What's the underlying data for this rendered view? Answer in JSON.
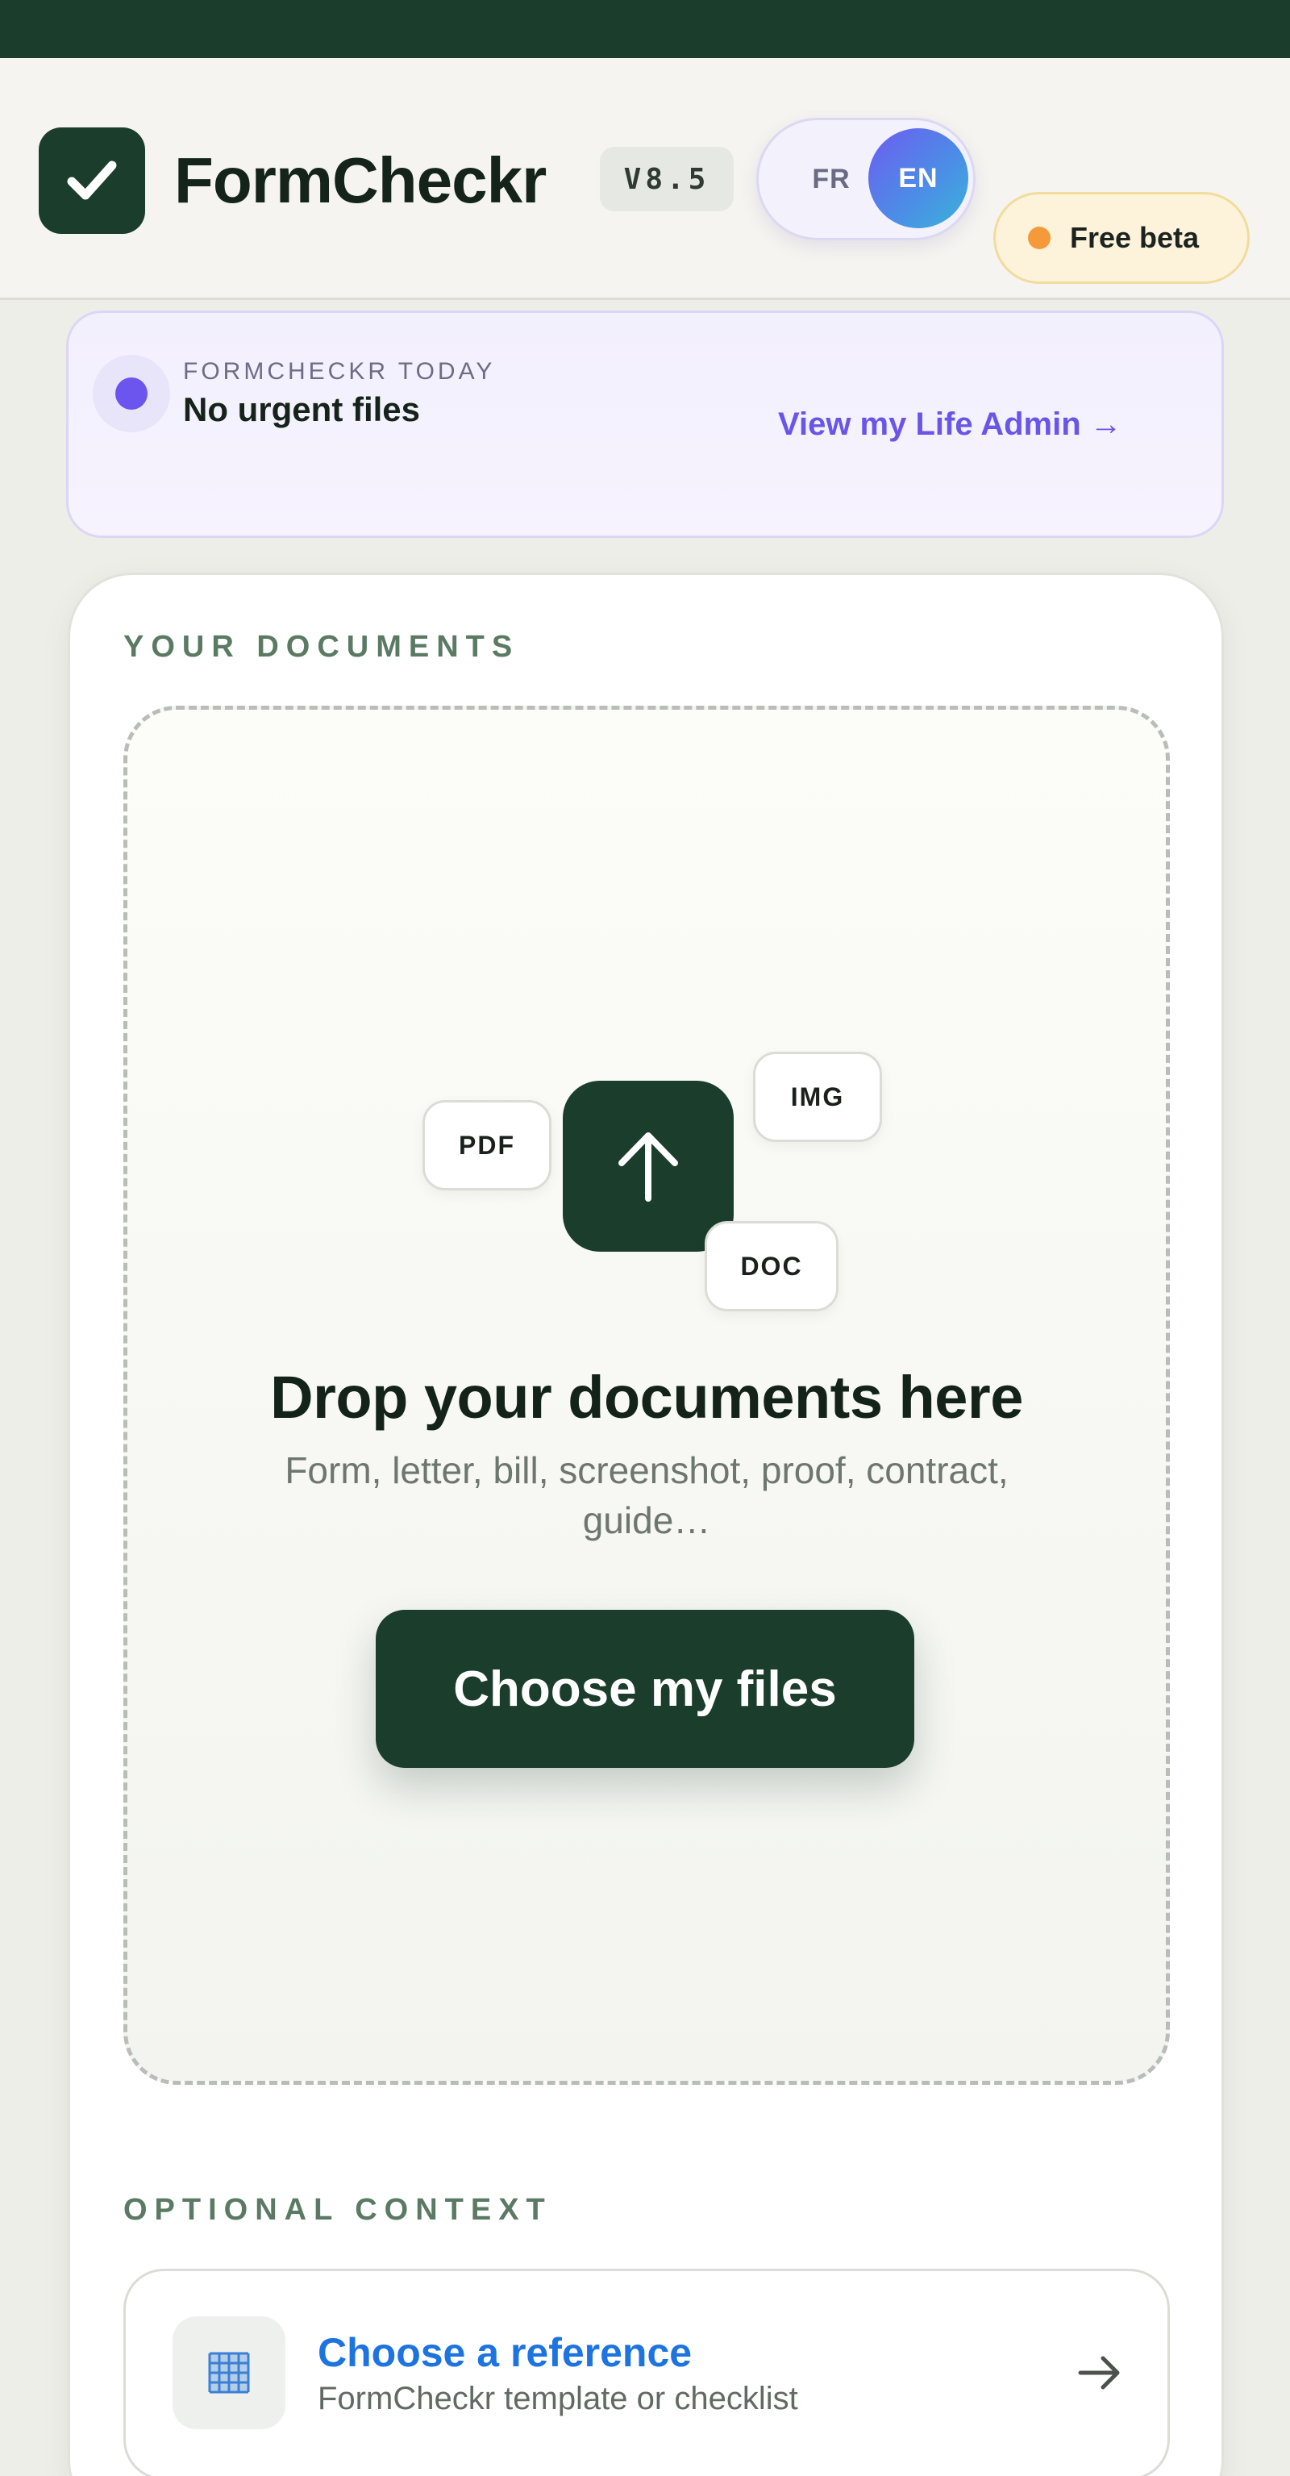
{
  "header": {
    "brand": "FormCheckr",
    "version": "V8.5",
    "languages": [
      "FR",
      "EN"
    ],
    "active_language": "EN",
    "beta_label": "Free beta"
  },
  "today": {
    "kicker": "FORMCHECKR TODAY",
    "title": "No urgent files",
    "link": "View my Life Admin →"
  },
  "documents": {
    "section_label": "YOUR DOCUMENTS",
    "chips": [
      "PDF",
      "IMG",
      "DOC"
    ],
    "drop_title": "Drop your documents here",
    "drop_subtitle": "Form, letter, bill, screenshot, proof, contract, guide…",
    "choose_button": "Choose my files"
  },
  "context": {
    "section_label": "OPTIONAL CONTEXT",
    "reference_title": "Choose a reference",
    "reference_subtitle": "FormCheckr template or checklist"
  },
  "colors": {
    "brand_green": "#1b3d2c",
    "accent_purple": "#6a55e8",
    "link_blue": "#1d74e0",
    "beta_dot": "#f59a3a"
  }
}
